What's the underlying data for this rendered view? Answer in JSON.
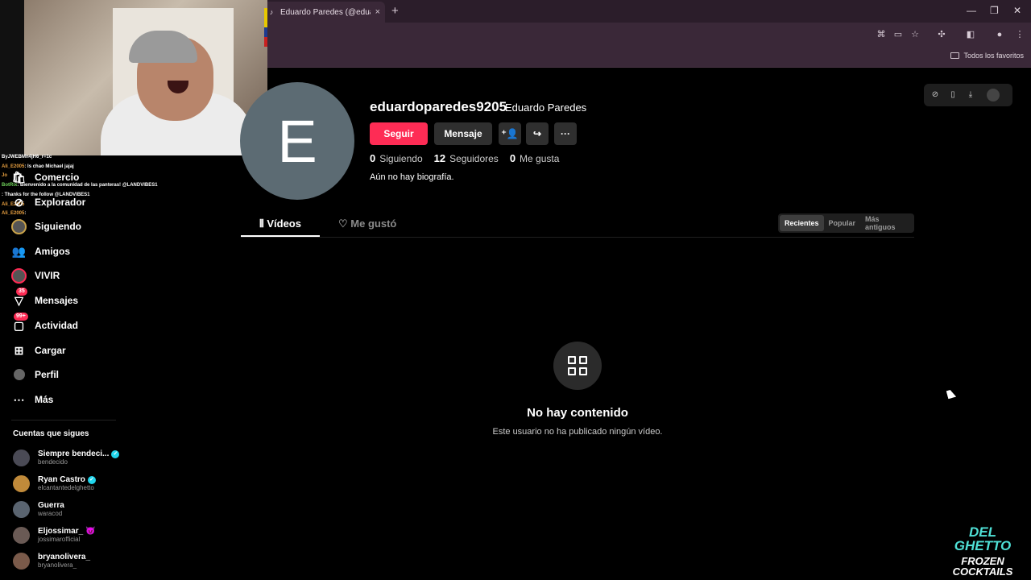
{
  "browser": {
    "tab_title": "Eduardo Paredes (@eduardopa",
    "tab_close": "×",
    "new_tab": "+",
    "bookmarks_label": "Todos los favoritos"
  },
  "chat": {
    "header": "ByJWEBMn4jH6_r=1c",
    "lines": [
      {
        "user": "Ali_E2005",
        "text": ": ls chao Michael jajaj"
      },
      {
        "user": "Jo",
        "text": ""
      },
      {
        "user": "BotRix",
        "text": ": Bienvenido a la comunidad de las panteras! @LANDVIBES1"
      },
      {
        "user": "",
        "text": ": Thanks for the follow @LANDVIBES1"
      },
      {
        "user": "Ali_E2005",
        "text": ""
      },
      {
        "user": "Ali_E2005",
        "text": ":"
      }
    ]
  },
  "sidebar": {
    "items": [
      {
        "label": "Comercio",
        "icon": "shop-icon"
      },
      {
        "label": "Explorador",
        "icon": "compass-icon"
      },
      {
        "label": "Siguiendo",
        "icon": "following-icon"
      },
      {
        "label": "Amigos",
        "icon": "friends-icon"
      },
      {
        "label": "VIVIR",
        "icon": "live-icon"
      },
      {
        "label": "Mensajes",
        "icon": "messages-icon",
        "badge": "35"
      },
      {
        "label": "Actividad",
        "icon": "activity-icon",
        "badge": "99+"
      },
      {
        "label": "Cargar",
        "icon": "upload-icon"
      },
      {
        "label": "Perfil",
        "icon": "profile-icon"
      },
      {
        "label": "Más",
        "icon": "more-icon"
      }
    ],
    "following_title": "Cuentas que sigues",
    "accounts": [
      {
        "name": "Siempre bendeci...",
        "handle": "bendecido",
        "verified": true
      },
      {
        "name": "Ryan Castro",
        "handle": "elcantantedelghetto",
        "verified": true
      },
      {
        "name": "Guerra",
        "handle": "waracod",
        "verified": false
      },
      {
        "name": "Eljossimar_",
        "handle": "jossimarofficial",
        "emoji": "😈"
      },
      {
        "name": "bryanolivera_",
        "handle": "bryanolivera_",
        "verified": false
      }
    ]
  },
  "profile": {
    "avatar_letter": "E",
    "username": "eduardoparedes9205",
    "display_name": "Eduardo Paredes",
    "follow_label": "Seguir",
    "message_label": "Mensaje",
    "following_count": "0",
    "following_label": "Siguiendo",
    "followers_count": "12",
    "followers_label": "Seguidores",
    "likes_count": "0",
    "likes_label": "Me gusta",
    "bio": "Aún no hay biografía."
  },
  "tabs": {
    "videos": "Vídeos",
    "liked": "Me gustó"
  },
  "sort": {
    "options": [
      "Recientes",
      "Popular",
      "Más antiguos"
    ],
    "selected": "Recientes"
  },
  "empty": {
    "title": "No hay contenido",
    "subtitle": "Este usuario no ha publicado ningún vídeo."
  },
  "logo": {
    "line1": "DEL GHETTO",
    "line2": "FROZEN",
    "line3": "COCKTAILS"
  },
  "colors": {
    "accent": "#fe2c55",
    "background": "#000000",
    "avatar_bg": "#5c6b73"
  }
}
